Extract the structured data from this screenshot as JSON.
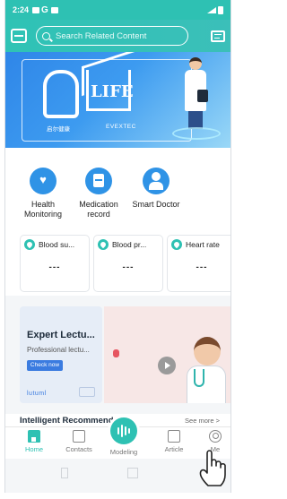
{
  "status_bar": {
    "time": "2:24",
    "carrier": "G"
  },
  "header": {
    "search_placeholder": "Search Related Content"
  },
  "banner": {
    "brand_text": "LIFE",
    "caption_cn": "启尔健康",
    "caption_en": "EVEXTEC"
  },
  "quick_actions": [
    {
      "label": "Health Monitoring",
      "icon": "heart-monitor-icon"
    },
    {
      "label": "Medication record",
      "icon": "medication-record-icon"
    },
    {
      "label": "Smart Doctor",
      "icon": "doctor-icon"
    }
  ],
  "metrics": [
    {
      "label": "Blood su...",
      "value": "---"
    },
    {
      "label": "Blood pr...",
      "value": "---"
    },
    {
      "label": "Heart rate",
      "value": "---"
    }
  ],
  "lecture": {
    "title": "Expert Lectu...",
    "subtitle": "Professional lectu...",
    "button": "Check now",
    "logo_text": "lutuml"
  },
  "recommendations": {
    "title": "Intelligent Recommendation",
    "more": "See more >"
  },
  "nav": [
    {
      "label": "Home",
      "icon": "home-icon",
      "active": true
    },
    {
      "label": "Contacts",
      "icon": "contacts-icon",
      "active": false
    },
    {
      "label": "Modeling",
      "icon": "voice-wave-icon",
      "active": false
    },
    {
      "label": "Article",
      "icon": "article-icon",
      "active": false
    },
    {
      "label": "Me",
      "icon": "user-icon",
      "active": false
    }
  ],
  "colors": {
    "primary": "#2ec1b3",
    "accent_blue": "#2f93e6"
  }
}
